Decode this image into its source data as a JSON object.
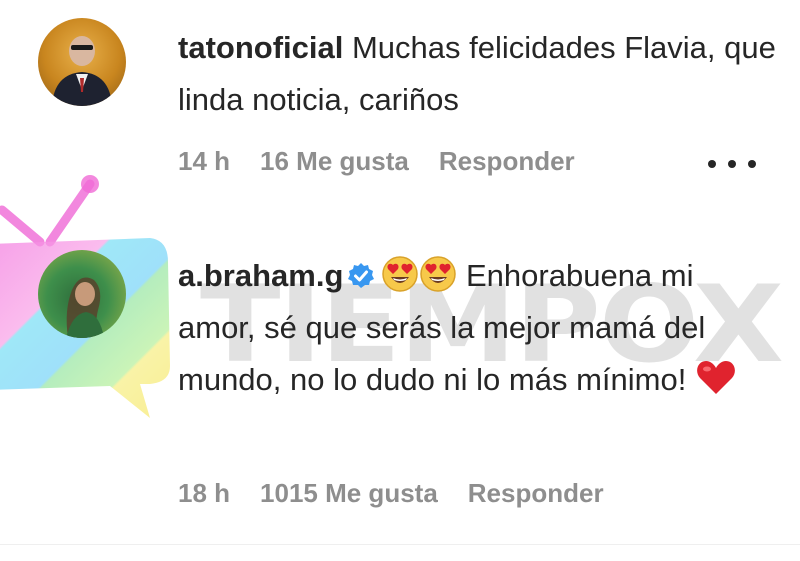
{
  "watermark": {
    "text": "TIEMPOX"
  },
  "comments": [
    {
      "username": "tatonoficial",
      "text": " Muchas felicidades Flavia, que linda noticia, cariños",
      "time": "14 h",
      "likes": "16 Me gusta",
      "reply": "Responder",
      "verified": false
    },
    {
      "username": "a.braham.g",
      "text_after_emoji": " Enhorabuena mi amor, sé que serás la mejor mamá del mundo, no lo dudo ni lo más mínimo! ",
      "time": "18 h",
      "likes": "1015 Me gusta",
      "reply": "Responder",
      "verified": true
    }
  ],
  "colors": {
    "text": "#262626",
    "meta": "#8e8e8e",
    "verified": "#3897f0",
    "heart": "#e0232e"
  }
}
